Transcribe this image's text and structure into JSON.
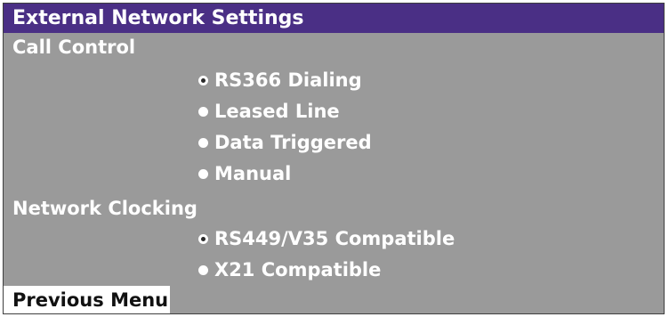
{
  "title": "External Network Settings",
  "sections": {
    "call_control": {
      "label": "Call Control",
      "options": [
        {
          "label": "RS366 Dialing",
          "selected": true
        },
        {
          "label": "Leased Line",
          "selected": false
        },
        {
          "label": "Data Triggered",
          "selected": false
        },
        {
          "label": "Manual",
          "selected": false
        }
      ]
    },
    "network_clocking": {
      "label": "Network Clocking",
      "options": [
        {
          "label": "RS449/V35 Compatible",
          "selected": true
        },
        {
          "label": "X21 Compatible",
          "selected": false
        }
      ]
    }
  },
  "footer": {
    "previous_menu_label": "Previous Menu"
  },
  "colors": {
    "title_bar": "#4a2f85",
    "background": "#9a9a9a",
    "text": "#ffffff",
    "highlight_bg": "#ffffff",
    "highlight_text": "#111111"
  }
}
